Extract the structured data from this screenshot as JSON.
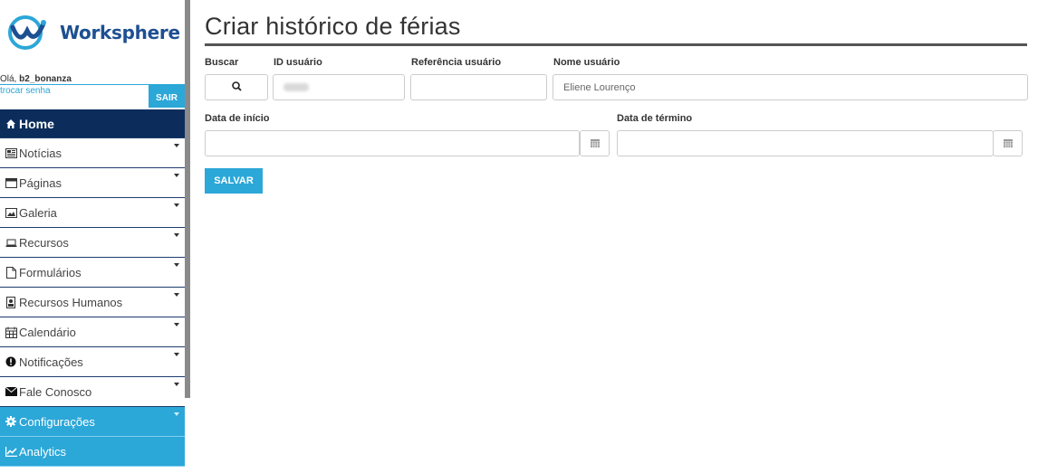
{
  "app": {
    "logo_text": "Worksphere",
    "accent": "#2ba7d8",
    "nav_dark": "#0c2d5c"
  },
  "user": {
    "greeting_prefix": "Olá, ",
    "username": "b2_bonanza",
    "change_password": "trocar senha",
    "logout": "SAIR"
  },
  "nav": {
    "home": {
      "label": "Home",
      "icon": "home-icon"
    },
    "items": [
      {
        "label": "Notícias",
        "icon": "newspaper-icon"
      },
      {
        "label": "Páginas",
        "icon": "window-icon"
      },
      {
        "label": "Galeria",
        "icon": "image-icon"
      },
      {
        "label": "Recursos",
        "icon": "laptop-icon"
      },
      {
        "label": "Formulários",
        "icon": "file-icon"
      },
      {
        "label": "Recursos Humanos",
        "icon": "badge-icon"
      },
      {
        "label": "Calendário",
        "icon": "calendar-icon"
      },
      {
        "label": "Notificações",
        "icon": "exclamation-icon"
      },
      {
        "label": "Fale Conosco",
        "icon": "envelope-icon"
      }
    ],
    "blue_items": [
      {
        "label": "Configurações",
        "icon": "gear-icon"
      },
      {
        "label": "Analytics",
        "icon": "chart-icon"
      }
    ]
  },
  "page": {
    "title": "Criar histórico de férias",
    "labels": {
      "search": "Buscar",
      "user_id": "ID usuário",
      "user_ref": "Referência usuário",
      "user_name": "Nome usuário",
      "start_date": "Data de início",
      "end_date": "Data de término"
    },
    "user_name_placeholder": "Eliene Lourenço",
    "save": "SALVAR"
  }
}
